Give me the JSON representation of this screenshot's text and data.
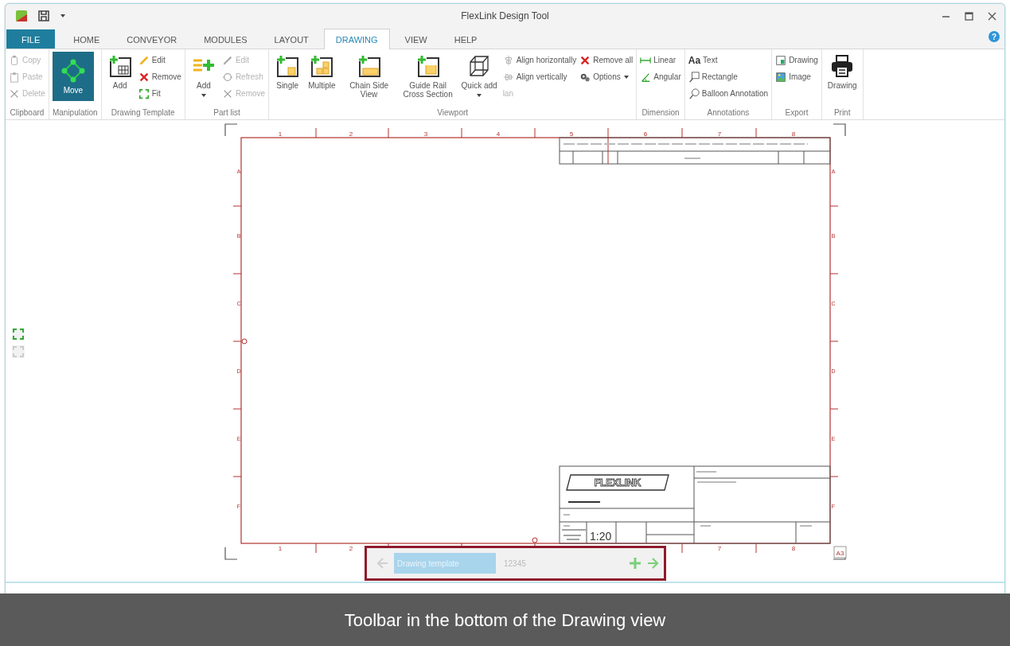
{
  "window": {
    "title": "FlexLink Design Tool"
  },
  "tabs": [
    {
      "label": "FILE",
      "kind": "file",
      "selected": false
    },
    {
      "label": "HOME",
      "kind": "tab",
      "selected": false
    },
    {
      "label": "CONVEYOR",
      "kind": "tab",
      "selected": false
    },
    {
      "label": "MODULES",
      "kind": "tab",
      "selected": false
    },
    {
      "label": "LAYOUT",
      "kind": "tab",
      "selected": false
    },
    {
      "label": "DRAWING",
      "kind": "tab",
      "selected": true
    },
    {
      "label": "VIEW",
      "kind": "tab",
      "selected": false
    },
    {
      "label": "HELP",
      "kind": "tab",
      "selected": false
    }
  ],
  "help_button": "?",
  "ribbon": {
    "groups": [
      {
        "label": "Clipboard",
        "items": [
          {
            "label": "Copy",
            "kind": "small",
            "disabled": true,
            "active": false
          },
          {
            "label": "Paste",
            "kind": "small",
            "disabled": true,
            "active": false
          },
          {
            "label": "Delete",
            "kind": "small",
            "disabled": true,
            "active": false
          }
        ]
      },
      {
        "label": "Manipulation",
        "items": [
          {
            "label": "Move",
            "kind": "large",
            "disabled": false,
            "active": true
          }
        ]
      },
      {
        "label": "Drawing Template",
        "items": [
          {
            "label": "Add",
            "kind": "large",
            "disabled": false,
            "active": false
          },
          {
            "label": "Edit",
            "kind": "small",
            "disabled": false,
            "active": false
          },
          {
            "label": "Remove",
            "kind": "small",
            "disabled": false,
            "active": false
          },
          {
            "label": "Fit",
            "kind": "small",
            "disabled": false,
            "active": false
          }
        ]
      },
      {
        "label": "Part list",
        "items": [
          {
            "label": "Add",
            "kind": "large-menu",
            "disabled": false,
            "active": false
          },
          {
            "label": "Edit",
            "kind": "small",
            "disabled": true,
            "active": false
          },
          {
            "label": "Refresh",
            "kind": "small",
            "disabled": true,
            "active": false
          },
          {
            "label": "Remove",
            "kind": "small",
            "disabled": true,
            "active": false
          }
        ]
      },
      {
        "label": "Viewport",
        "items": [
          {
            "label": "Single",
            "kind": "large",
            "disabled": false,
            "active": false
          },
          {
            "label": "Multiple",
            "kind": "large",
            "disabled": false,
            "active": false
          },
          {
            "label": "Chain Side View",
            "kind": "large",
            "disabled": false,
            "active": false
          },
          {
            "label": "Guide Rail Cross Section",
            "kind": "large",
            "disabled": false,
            "active": false
          },
          {
            "label": "Quick add",
            "kind": "large-menu",
            "disabled": false,
            "active": false
          },
          {
            "label": "Align horizontally",
            "kind": "small",
            "disabled": false,
            "active": false
          },
          {
            "label": "Align vertically",
            "kind": "small",
            "disabled": false,
            "active": false
          },
          {
            "label": "lan",
            "kind": "small",
            "disabled": true,
            "active": false
          },
          {
            "label": "Remove all",
            "kind": "small",
            "disabled": false,
            "active": false
          },
          {
            "label": "Options",
            "kind": "small-menu",
            "disabled": false,
            "active": false
          }
        ]
      },
      {
        "label": "Dimension",
        "items": [
          {
            "label": "Linear",
            "kind": "small",
            "disabled": false,
            "active": false
          },
          {
            "label": "Angular",
            "kind": "small",
            "disabled": false,
            "active": false
          }
        ]
      },
      {
        "label": "Annotations",
        "items": [
          {
            "label": "Text",
            "kind": "small",
            "glyph": "Aa",
            "disabled": false,
            "active": false
          },
          {
            "label": "Rectangle",
            "kind": "small",
            "disabled": false,
            "active": false
          },
          {
            "label": "Balloon Annotation",
            "kind": "small",
            "disabled": false,
            "active": false
          }
        ]
      },
      {
        "label": "Export",
        "items": [
          {
            "label": "Drawing",
            "kind": "small",
            "disabled": false,
            "active": false
          },
          {
            "label": "Image",
            "kind": "small",
            "disabled": false,
            "active": false
          }
        ]
      },
      {
        "label": "Print",
        "items": [
          {
            "label": "Drawing",
            "kind": "large",
            "disabled": false,
            "active": false
          }
        ]
      }
    ]
  },
  "sheet": {
    "top_columns": [
      "1",
      "2",
      "3",
      "4",
      "5",
      "6",
      "7",
      "8"
    ],
    "bottom_columns": [
      "1",
      "2",
      "7",
      "8"
    ],
    "left_rows": [
      "A",
      "B",
      "C",
      "D",
      "E",
      "F"
    ],
    "right_rows": [
      "A",
      "B",
      "C",
      "D",
      "E",
      "F"
    ],
    "logo": "FLEXLINK",
    "scale": "1:20",
    "size": "A3"
  },
  "bottom_toolbar": {
    "back": {
      "disabled": true
    },
    "template_field": {
      "value": "Drawing template"
    },
    "page_field": {
      "placeholder": "12345"
    },
    "add": {
      "disabled": false
    },
    "forward": {
      "disabled": false
    }
  },
  "caption": "Toolbar in the bottom of the Drawing view"
}
